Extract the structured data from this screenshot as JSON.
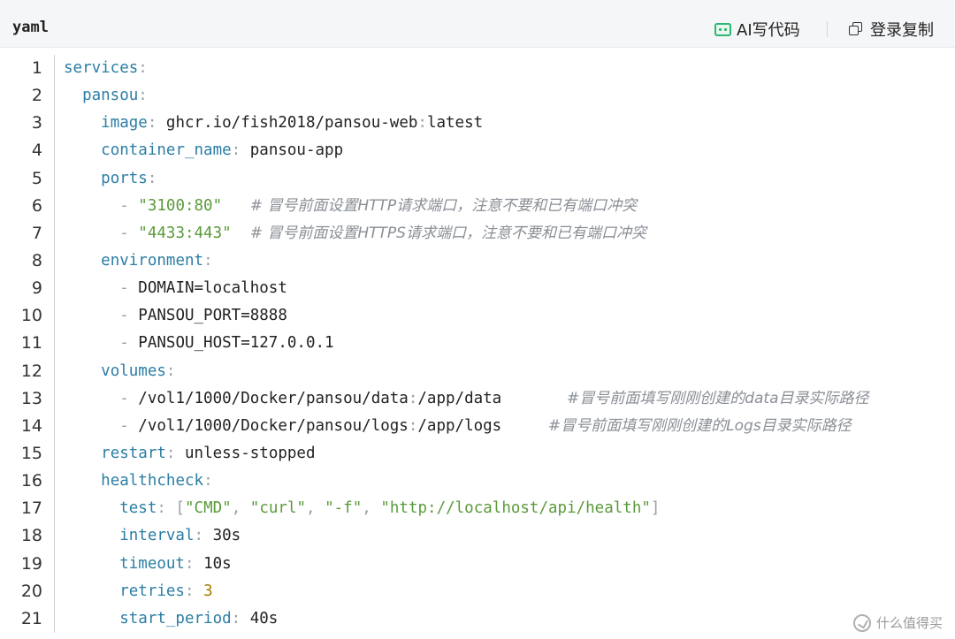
{
  "header": {
    "language": "yaml",
    "ai_button_label": "AI写代码",
    "copy_button_label": "登录复制"
  },
  "code": {
    "lines": [
      {
        "n": "1",
        "tokens": [
          [
            "k",
            "services"
          ],
          [
            "p",
            ":"
          ]
        ]
      },
      {
        "n": "2",
        "tokens": [
          [
            "v",
            "  "
          ],
          [
            "k",
            "pansou"
          ],
          [
            "p",
            ":"
          ]
        ]
      },
      {
        "n": "3",
        "tokens": [
          [
            "v",
            "    "
          ],
          [
            "k",
            "image"
          ],
          [
            "p",
            ":"
          ],
          [
            "v",
            " ghcr.io/fish2018/pansou-web"
          ],
          [
            "p",
            ":"
          ],
          [
            "v",
            "latest"
          ]
        ]
      },
      {
        "n": "4",
        "tokens": [
          [
            "v",
            "    "
          ],
          [
            "k",
            "container_name"
          ],
          [
            "p",
            ":"
          ],
          [
            "v",
            " pansou-app"
          ]
        ]
      },
      {
        "n": "5",
        "tokens": [
          [
            "v",
            "    "
          ],
          [
            "k",
            "ports"
          ],
          [
            "p",
            ":"
          ]
        ]
      },
      {
        "n": "6",
        "tokens": [
          [
            "v",
            "      "
          ],
          [
            "p",
            "- "
          ],
          [
            "s",
            "\"3100:80\""
          ],
          [
            "v",
            "   "
          ],
          [
            "c",
            "# 冒号前面设置HTTP请求端口，注意不要和已有端口冲突"
          ]
        ]
      },
      {
        "n": "7",
        "tokens": [
          [
            "v",
            "      "
          ],
          [
            "p",
            "- "
          ],
          [
            "s",
            "\"4433:443\""
          ],
          [
            "v",
            "  "
          ],
          [
            "c",
            "# 冒号前面设置HTTPS请求端口，注意不要和已有端口冲突"
          ]
        ]
      },
      {
        "n": "8",
        "tokens": [
          [
            "v",
            "    "
          ],
          [
            "k",
            "environment"
          ],
          [
            "p",
            ":"
          ]
        ]
      },
      {
        "n": "9",
        "tokens": [
          [
            "v",
            "      "
          ],
          [
            "p",
            "- "
          ],
          [
            "v",
            "DOMAIN=localhost"
          ]
        ]
      },
      {
        "n": "10",
        "tokens": [
          [
            "v",
            "      "
          ],
          [
            "p",
            "- "
          ],
          [
            "v",
            "PANSOU_PORT=8888"
          ]
        ]
      },
      {
        "n": "11",
        "tokens": [
          [
            "v",
            "      "
          ],
          [
            "p",
            "- "
          ],
          [
            "v",
            "PANSOU_HOST=127.0.0.1"
          ]
        ]
      },
      {
        "n": "12",
        "tokens": [
          [
            "v",
            "    "
          ],
          [
            "k",
            "volumes"
          ],
          [
            "p",
            ":"
          ]
        ]
      },
      {
        "n": "13",
        "tokens": [
          [
            "v",
            "      "
          ],
          [
            "p",
            "- "
          ],
          [
            "v",
            "/vol1/1000/Docker/pansou/data"
          ],
          [
            "p",
            ":"
          ],
          [
            "v",
            "/app/data       "
          ],
          [
            "c",
            "#冒号前面填写刚刚创建的data目录实际路径"
          ]
        ]
      },
      {
        "n": "14",
        "tokens": [
          [
            "v",
            "      "
          ],
          [
            "p",
            "- "
          ],
          [
            "v",
            "/vol1/1000/Docker/pansou/logs"
          ],
          [
            "p",
            ":"
          ],
          [
            "v",
            "/app/logs     "
          ],
          [
            "c",
            "#冒号前面填写刚刚创建的Logs目录实际路径"
          ]
        ]
      },
      {
        "n": "15",
        "tokens": [
          [
            "v",
            "    "
          ],
          [
            "k",
            "restart"
          ],
          [
            "p",
            ":"
          ],
          [
            "v",
            " unless-stopped"
          ]
        ]
      },
      {
        "n": "16",
        "tokens": [
          [
            "v",
            "    "
          ],
          [
            "k",
            "healthcheck"
          ],
          [
            "p",
            ":"
          ]
        ]
      },
      {
        "n": "17",
        "tokens": [
          [
            "v",
            "      "
          ],
          [
            "k",
            "test"
          ],
          [
            "p",
            ":"
          ],
          [
            "v",
            " "
          ],
          [
            "p",
            "["
          ],
          [
            "s",
            "\"CMD\""
          ],
          [
            "p",
            ","
          ],
          [
            "v",
            " "
          ],
          [
            "s",
            "\"curl\""
          ],
          [
            "p",
            ","
          ],
          [
            "v",
            " "
          ],
          [
            "s",
            "\"-f\""
          ],
          [
            "p",
            ","
          ],
          [
            "v",
            " "
          ],
          [
            "s",
            "\"http://localhost/api/health\""
          ],
          [
            "p",
            "]"
          ]
        ]
      },
      {
        "n": "18",
        "tokens": [
          [
            "v",
            "      "
          ],
          [
            "k",
            "interval"
          ],
          [
            "p",
            ":"
          ],
          [
            "v",
            " 30s"
          ]
        ]
      },
      {
        "n": "19",
        "tokens": [
          [
            "v",
            "      "
          ],
          [
            "k",
            "timeout"
          ],
          [
            "p",
            ":"
          ],
          [
            "v",
            " 10s"
          ]
        ]
      },
      {
        "n": "20",
        "tokens": [
          [
            "v",
            "      "
          ],
          [
            "k",
            "retries"
          ],
          [
            "p",
            ":"
          ],
          [
            "v",
            " "
          ],
          [
            "n",
            "3"
          ]
        ]
      },
      {
        "n": "21",
        "tokens": [
          [
            "v",
            "      "
          ],
          [
            "k",
            "start_period"
          ],
          [
            "p",
            ":"
          ],
          [
            "v",
            " 40s"
          ]
        ]
      }
    ]
  },
  "watermark": {
    "text": "什么值得买"
  },
  "colors": {
    "key": "#2b7ea4",
    "string": "#5a9a3a",
    "number": "#a67c00",
    "comment": "#8a8f96",
    "punct": "#9aa0a6",
    "ai_icon": "#2bb673"
  }
}
